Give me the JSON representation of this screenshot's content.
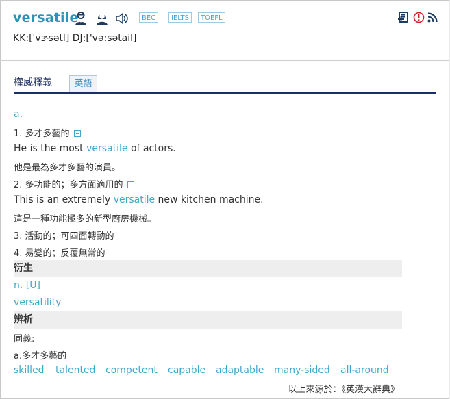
{
  "entry": {
    "word": "versatile",
    "pron_kk": "KK:['vɝsətl] ",
    "pron_dj": "DJ:['və:sətail]",
    "tags": [
      "BEC",
      "IELTS",
      "TOEFL"
    ]
  },
  "icons": {
    "male_speaker": "male-speaker-icon",
    "female_speaker": "female-speaker-icon",
    "audio": "speaker-icon",
    "add_to_vocab": "add-vocab-icon",
    "report": "alert-icon",
    "rss": "rss-icon"
  },
  "tabs": {
    "title": "權威釋義",
    "english": "英語"
  },
  "definition": {
    "pos": "a.",
    "senses": [
      {
        "text": "1. 多才多藝的",
        "example_pre": "He is the most ",
        "example_hl": "versatile",
        "example_post": " of actors.",
        "translation": "他是最為多才多藝的演員。"
      },
      {
        "text": "2. 多功能的；多方面適用的",
        "example_pre": "This is an extremely ",
        "example_hl": "versatile",
        "example_post": " new kitchen machine.",
        "translation": "這是一種功能極多的新型廚房機械。"
      },
      {
        "text": "3. 活動的；可四面轉動的"
      },
      {
        "text": "4. 易變的；反覆無常的"
      }
    ]
  },
  "derived": {
    "heading": "衍生",
    "pos": "n. [U]",
    "word": "versatility"
  },
  "analysis": {
    "heading": "辨析",
    "syn_label": "同義:",
    "syn_sense": "a.多才多藝的",
    "synonyms": [
      "skilled",
      "talented",
      "competent",
      "capable",
      "adaptable",
      "many-sided",
      "all-around"
    ]
  },
  "source": "以上來源於：《英漢大辭典》",
  "colors": {
    "accent": "#3fa9c9",
    "word": "#2a93b8",
    "navy": "#1c2d6b",
    "section_bg": "#eeeeee"
  }
}
